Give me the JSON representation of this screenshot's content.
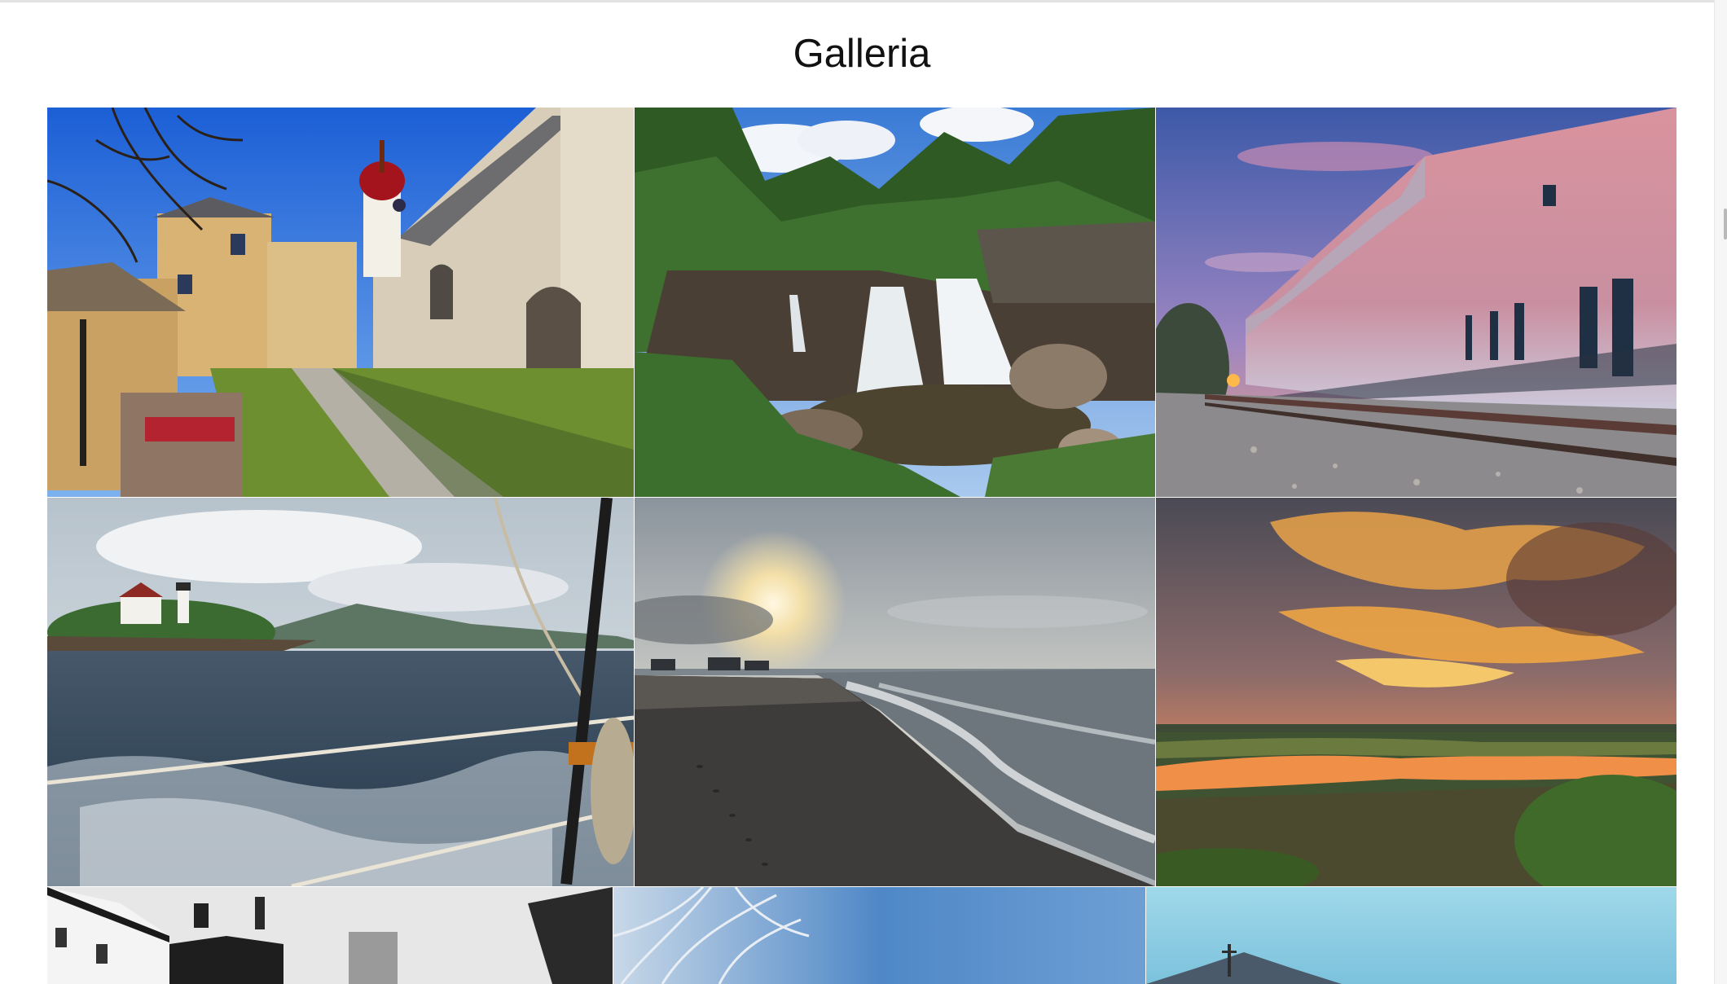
{
  "gallery": {
    "title": "Galleria",
    "photos": [
      {
        "name": "church-courtyard-photo"
      },
      {
        "name": "waterfall-photo"
      },
      {
        "name": "pink-building-railway-photo"
      },
      {
        "name": "lighthouse-sailing-photo"
      },
      {
        "name": "beach-sunset-photo"
      },
      {
        "name": "marsh-sunset-photo"
      },
      {
        "name": "bw-houses-photo"
      },
      {
        "name": "frosted-tree-photo"
      },
      {
        "name": "blue-sky-steeple-photo"
      }
    ]
  },
  "colors": {
    "background": "#ffffff",
    "title_text": "#111111"
  }
}
